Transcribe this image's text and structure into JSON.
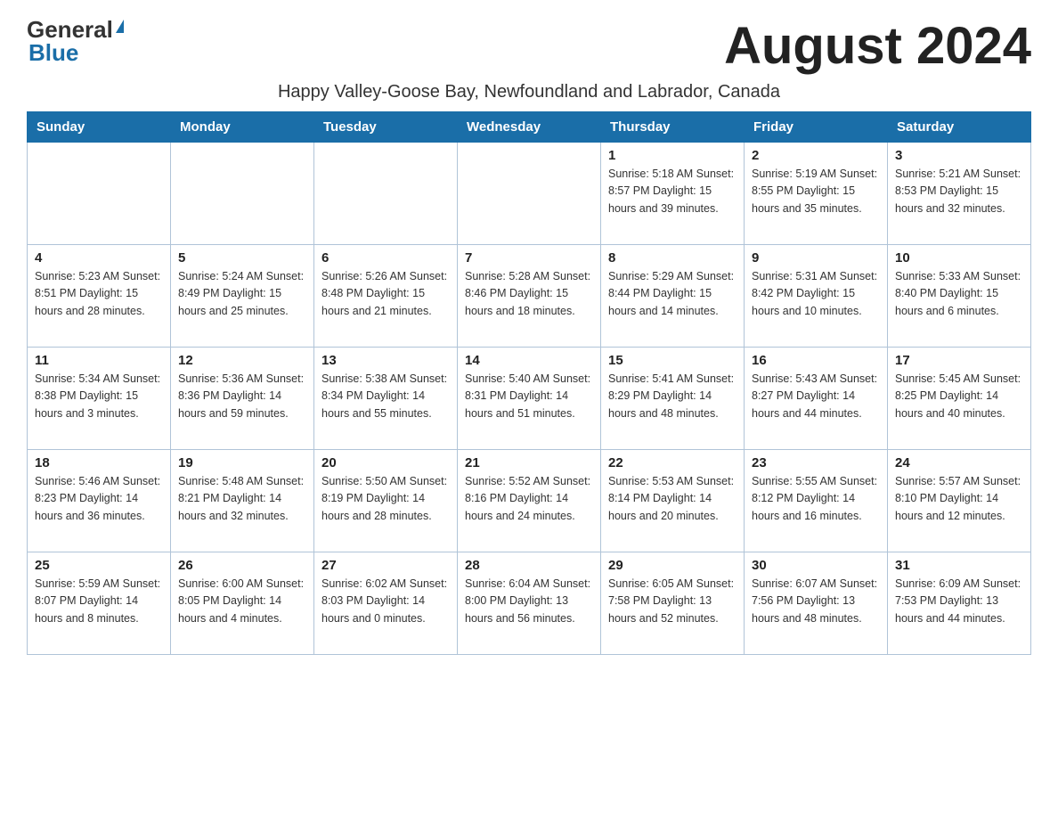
{
  "logo": {
    "general": "General",
    "triangle": "▶",
    "blue": "Blue"
  },
  "title": "August 2024",
  "subtitle": "Happy Valley-Goose Bay, Newfoundland and Labrador, Canada",
  "days_of_week": [
    "Sunday",
    "Monday",
    "Tuesday",
    "Wednesday",
    "Thursday",
    "Friday",
    "Saturday"
  ],
  "weeks": [
    [
      {
        "day": "",
        "info": ""
      },
      {
        "day": "",
        "info": ""
      },
      {
        "day": "",
        "info": ""
      },
      {
        "day": "",
        "info": ""
      },
      {
        "day": "1",
        "info": "Sunrise: 5:18 AM\nSunset: 8:57 PM\nDaylight: 15 hours and 39 minutes."
      },
      {
        "day": "2",
        "info": "Sunrise: 5:19 AM\nSunset: 8:55 PM\nDaylight: 15 hours and 35 minutes."
      },
      {
        "day": "3",
        "info": "Sunrise: 5:21 AM\nSunset: 8:53 PM\nDaylight: 15 hours and 32 minutes."
      }
    ],
    [
      {
        "day": "4",
        "info": "Sunrise: 5:23 AM\nSunset: 8:51 PM\nDaylight: 15 hours and 28 minutes."
      },
      {
        "day": "5",
        "info": "Sunrise: 5:24 AM\nSunset: 8:49 PM\nDaylight: 15 hours and 25 minutes."
      },
      {
        "day": "6",
        "info": "Sunrise: 5:26 AM\nSunset: 8:48 PM\nDaylight: 15 hours and 21 minutes."
      },
      {
        "day": "7",
        "info": "Sunrise: 5:28 AM\nSunset: 8:46 PM\nDaylight: 15 hours and 18 minutes."
      },
      {
        "day": "8",
        "info": "Sunrise: 5:29 AM\nSunset: 8:44 PM\nDaylight: 15 hours and 14 minutes."
      },
      {
        "day": "9",
        "info": "Sunrise: 5:31 AM\nSunset: 8:42 PM\nDaylight: 15 hours and 10 minutes."
      },
      {
        "day": "10",
        "info": "Sunrise: 5:33 AM\nSunset: 8:40 PM\nDaylight: 15 hours and 6 minutes."
      }
    ],
    [
      {
        "day": "11",
        "info": "Sunrise: 5:34 AM\nSunset: 8:38 PM\nDaylight: 15 hours and 3 minutes."
      },
      {
        "day": "12",
        "info": "Sunrise: 5:36 AM\nSunset: 8:36 PM\nDaylight: 14 hours and 59 minutes."
      },
      {
        "day": "13",
        "info": "Sunrise: 5:38 AM\nSunset: 8:34 PM\nDaylight: 14 hours and 55 minutes."
      },
      {
        "day": "14",
        "info": "Sunrise: 5:40 AM\nSunset: 8:31 PM\nDaylight: 14 hours and 51 minutes."
      },
      {
        "day": "15",
        "info": "Sunrise: 5:41 AM\nSunset: 8:29 PM\nDaylight: 14 hours and 48 minutes."
      },
      {
        "day": "16",
        "info": "Sunrise: 5:43 AM\nSunset: 8:27 PM\nDaylight: 14 hours and 44 minutes."
      },
      {
        "day": "17",
        "info": "Sunrise: 5:45 AM\nSunset: 8:25 PM\nDaylight: 14 hours and 40 minutes."
      }
    ],
    [
      {
        "day": "18",
        "info": "Sunrise: 5:46 AM\nSunset: 8:23 PM\nDaylight: 14 hours and 36 minutes."
      },
      {
        "day": "19",
        "info": "Sunrise: 5:48 AM\nSunset: 8:21 PM\nDaylight: 14 hours and 32 minutes."
      },
      {
        "day": "20",
        "info": "Sunrise: 5:50 AM\nSunset: 8:19 PM\nDaylight: 14 hours and 28 minutes."
      },
      {
        "day": "21",
        "info": "Sunrise: 5:52 AM\nSunset: 8:16 PM\nDaylight: 14 hours and 24 minutes."
      },
      {
        "day": "22",
        "info": "Sunrise: 5:53 AM\nSunset: 8:14 PM\nDaylight: 14 hours and 20 minutes."
      },
      {
        "day": "23",
        "info": "Sunrise: 5:55 AM\nSunset: 8:12 PM\nDaylight: 14 hours and 16 minutes."
      },
      {
        "day": "24",
        "info": "Sunrise: 5:57 AM\nSunset: 8:10 PM\nDaylight: 14 hours and 12 minutes."
      }
    ],
    [
      {
        "day": "25",
        "info": "Sunrise: 5:59 AM\nSunset: 8:07 PM\nDaylight: 14 hours and 8 minutes."
      },
      {
        "day": "26",
        "info": "Sunrise: 6:00 AM\nSunset: 8:05 PM\nDaylight: 14 hours and 4 minutes."
      },
      {
        "day": "27",
        "info": "Sunrise: 6:02 AM\nSunset: 8:03 PM\nDaylight: 14 hours and 0 minutes."
      },
      {
        "day": "28",
        "info": "Sunrise: 6:04 AM\nSunset: 8:00 PM\nDaylight: 13 hours and 56 minutes."
      },
      {
        "day": "29",
        "info": "Sunrise: 6:05 AM\nSunset: 7:58 PM\nDaylight: 13 hours and 52 minutes."
      },
      {
        "day": "30",
        "info": "Sunrise: 6:07 AM\nSunset: 7:56 PM\nDaylight: 13 hours and 48 minutes."
      },
      {
        "day": "31",
        "info": "Sunrise: 6:09 AM\nSunset: 7:53 PM\nDaylight: 13 hours and 44 minutes."
      }
    ]
  ]
}
